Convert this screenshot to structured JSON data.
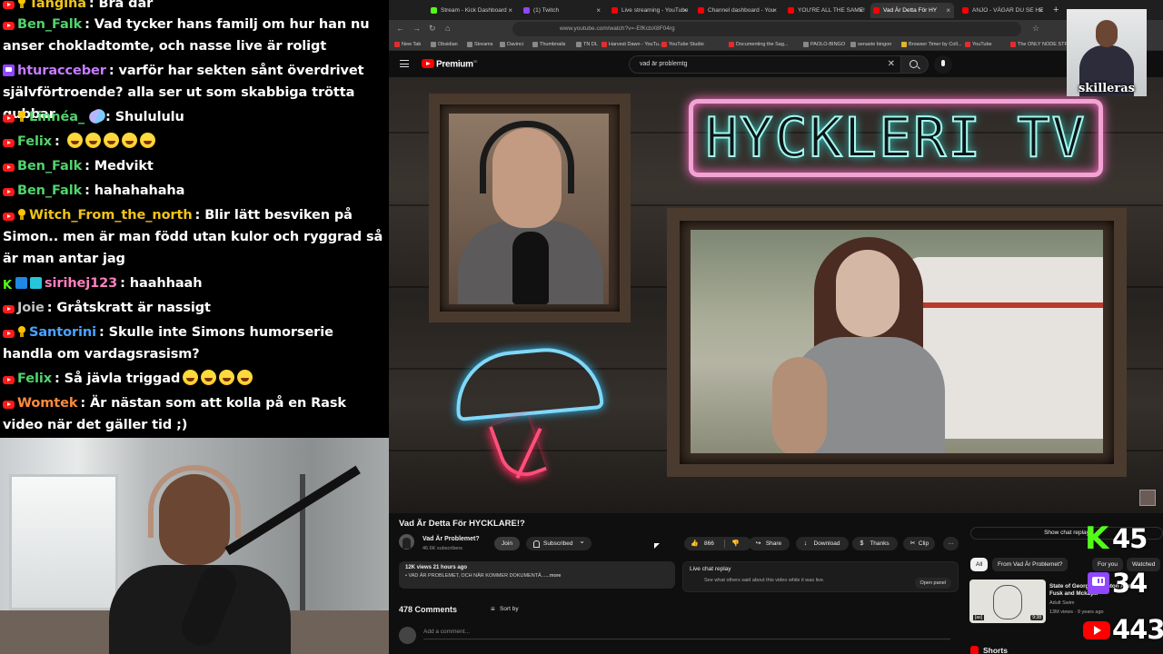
{
  "chat": {
    "messages": [
      {
        "badges": [
          "yt",
          "bulb"
        ],
        "user": "Tangina",
        "user_color": "#f0c419",
        "text": "Bra dar",
        "emotes": 0
      },
      {
        "badges": [
          "yt"
        ],
        "user": "Ben_Falk",
        "user_color": "#52d36c",
        "text": "Vad tycker hans familj om hur han nu anser chokladtomte, och nasse live är roligt",
        "emotes": 0
      },
      {
        "badges": [
          "tw"
        ],
        "user": "hturacceber",
        "user_color": "#c77dff",
        "text": "varför har sekten sånt överdrivet självförtroende? alla ser ut som skabbiga trötta gubbar",
        "emotes": 0
      },
      {
        "badges": [
          "yt",
          "bulb"
        ],
        "user": "Linnéa_",
        "user_color": "#52d36c",
        "text": "Shulululu",
        "emotes": 0
      },
      {
        "badges": [
          "yt"
        ],
        "user": "Felix",
        "user_color": "#52d36c",
        "text": "",
        "emotes": 5
      },
      {
        "badges": [
          "yt"
        ],
        "user": "Ben_Falk",
        "user_color": "#52d36c",
        "text": "Medvikt",
        "emotes": 0
      },
      {
        "badges": [
          "yt"
        ],
        "user": "Ben_Falk",
        "user_color": "#52d36c",
        "text": "hahahahaha",
        "emotes": 0
      },
      {
        "badges": [
          "yt",
          "bulb"
        ],
        "user": "Witch_From_the_north",
        "user_color": "#f0c419",
        "text": "Blir lätt besviken på Simon.. men är man född utan kulor och ryggrad så är man antar jag",
        "emotes": 0
      },
      {
        "badges": [
          "kick",
          "sq",
          "sq2"
        ],
        "user": "sirihej123",
        "user_color": "#ff7fbf",
        "text": "haahhaah",
        "emotes": 0
      },
      {
        "badges": [
          "yt"
        ],
        "user": "Joie",
        "user_color": "#c3c3c3",
        "text": "Gråtskratt är nassigt",
        "emotes": 0
      },
      {
        "badges": [
          "yt",
          "bulb"
        ],
        "user": "Santorini",
        "user_color": "#4aa3ff",
        "text": "Skulle inte Simons humorserie handla om vardagsrasism?",
        "emotes": 0
      },
      {
        "badges": [
          "yt"
        ],
        "user": "Felix",
        "user_color": "#52d36c",
        "text": "Så jävla triggad",
        "emotes": 4
      },
      {
        "badges": [
          "yt"
        ],
        "user": "Womtek",
        "user_color": "#ff8a3d",
        "text": "Är nästan som att kolla på en Rask video när det gäller tid ;)",
        "emotes": 0
      }
    ]
  },
  "browser": {
    "tabs": [
      {
        "label": "Stream - Kick Dashboard",
        "fav_color": "#53fc18",
        "active": false
      },
      {
        "label": "(1) Twitch",
        "fav_color": "#9146ff",
        "active": false
      },
      {
        "label": "Live streaming - YouTube",
        "fav_color": "#ff0000",
        "active": false
      },
      {
        "label": "Channel dashboard - You",
        "fav_color": "#ff0000",
        "active": false
      },
      {
        "label": "YOU'RE ALL THE SAME!",
        "fav_color": "#ff0000",
        "active": false
      },
      {
        "label": "Vad Är Detta För HY",
        "fav_color": "#ff0000",
        "active": true
      },
      {
        "label": "ANJO - VÄGAR DU SE HE",
        "fav_color": "#ff0000",
        "active": false
      }
    ],
    "url": "www.youtube.com/watch?v=-EfKcbX8F04rg",
    "bookmarks": [
      {
        "label": "New Tab",
        "c": "red"
      },
      {
        "label": "Obsidian",
        "c": ""
      },
      {
        "label": "Streams",
        "c": ""
      },
      {
        "label": "Davinci",
        "c": ""
      },
      {
        "label": "Thumbnails",
        "c": ""
      },
      {
        "label": "TN DL",
        "c": ""
      },
      {
        "label": "Harvest Dawn - YouTu...",
        "c": "red"
      },
      {
        "label": "YouTube Studio",
        "c": "red"
      },
      {
        "label": "Documenting the Sag...",
        "c": "red"
      },
      {
        "label": "PAOLO-BINGO",
        "c": ""
      },
      {
        "label": "senaste bingon",
        "c": ""
      },
      {
        "label": "Browser Timer by Coll...",
        "c": "yel"
      },
      {
        "label": "YouTube",
        "c": "red"
      },
      {
        "label": "The ONLY NODE STR...",
        "c": "red"
      }
    ]
  },
  "youtube": {
    "brand": "Premium",
    "brand_sup": "SE",
    "search_query": "vad är problemtg",
    "video": {
      "neon_title": "HYCKLERI TV",
      "title": "Vad Är Detta För HYCKLARE!?",
      "channel": "Vad Är Problemet?",
      "subscribers": "46.6K subscribers",
      "join_label": "Join",
      "subscribed_label": "Subscribed",
      "likes": "866",
      "share_label": "Share",
      "download_label": "Download",
      "thanks_label": "Thanks",
      "clip_label": "Clip",
      "more_label": "···",
      "meta": "12K views  21 hours ago",
      "desc_line": "• VAD ÄR PROBLEMET, OCH NÄR KOMMER DOKUMENTÄ...",
      "desc_more": "...more"
    },
    "live_chat": {
      "title": "Live chat replay",
      "description": "See what others said about this video while it was live.",
      "open_label": "Open panel"
    },
    "comments": {
      "count": "478 Comments",
      "sort_label": "Sort by",
      "placeholder": "Add a comment..."
    },
    "sidebar": {
      "show_chat": "Show chat replay",
      "chips": [
        "All",
        "From Vad Är Problemet?",
        "For you",
        "Watched"
      ],
      "rec": {
        "title": "State of Georgia... Fenton Allen | Fusk and Mckay...",
        "channel": "Adult Swim",
        "views": "13M views · 9 years ago",
        "duration": "9:38",
        "tag": "[as]"
      },
      "shorts_label": "Shorts"
    }
  },
  "overlay": {
    "host_name": "skilleras",
    "viewer_counts": [
      {
        "platform": "kick",
        "count": "45"
      },
      {
        "platform": "twitch",
        "count": "34"
      },
      {
        "platform": "youtube",
        "count": "443"
      }
    ]
  }
}
